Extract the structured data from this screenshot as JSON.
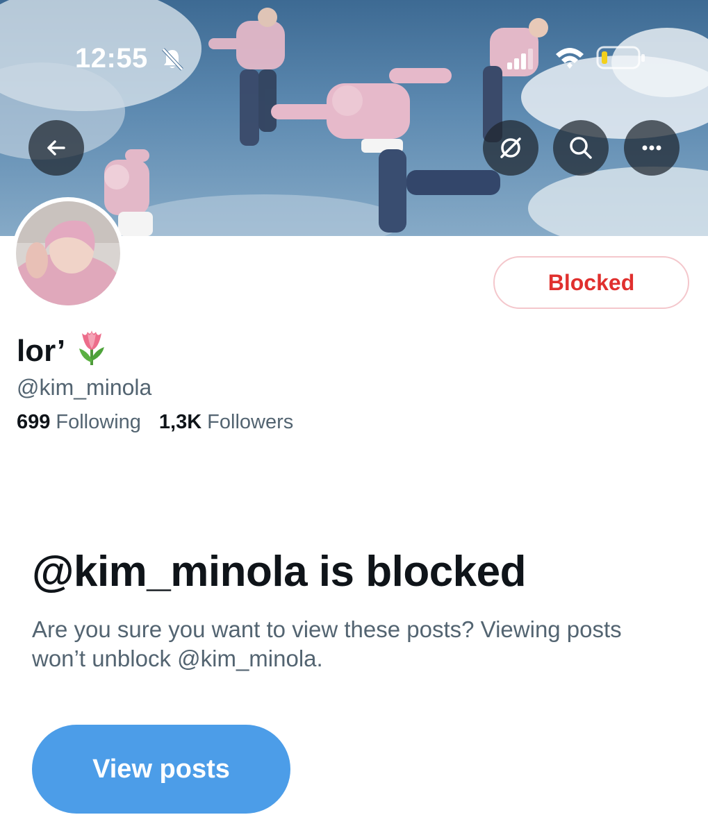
{
  "status_bar": {
    "time": "12:55",
    "icons": [
      "bell-slash-icon",
      "cellular-signal-icon",
      "wifi-icon",
      "battery-low-icon"
    ]
  },
  "header": {
    "buttons": [
      "back-arrow-icon",
      "translate-icon",
      "search-icon",
      "more-icon"
    ]
  },
  "profile": {
    "display_name": "lor’",
    "name_emoji": "tulip-emoji",
    "handle": "@kim_minola",
    "following_count": "699",
    "following_label": "Following",
    "followers_count": "1,3K",
    "followers_label": "Followers",
    "blocked_button_label": "Blocked"
  },
  "blocked_notice": {
    "title": "@kim_minola is blocked",
    "body": "Are you sure you want to view these posts? Viewing posts won’t unblock @kim_minola.",
    "view_posts_label": "View posts"
  },
  "colors": {
    "blocked_red": "#e0302e",
    "blocked_border": "#f4c7cc",
    "primary_blue": "#4c9de8",
    "text_primary": "#0f1419",
    "text_secondary": "#536471"
  }
}
